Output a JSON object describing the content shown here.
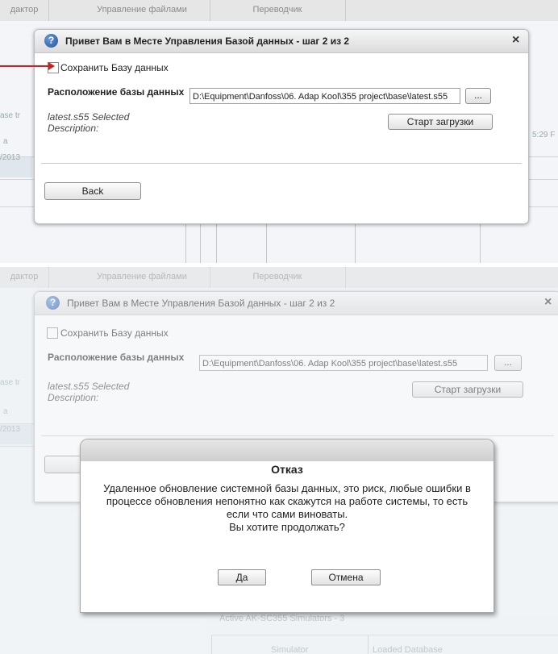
{
  "app": {
    "tabs": [
      "дактор",
      "Управление файлами",
      "Переводчик"
    ],
    "bg_left_labels": [
      "ase tr",
      "a",
      "/2013"
    ],
    "bg_time": "5:29 F",
    "bg_section_title": "Active AK-SC355 Simulators - 3",
    "bg_table_headers": [
      "Simulator",
      "Loaded Database"
    ]
  },
  "wizard": {
    "title": "Привет Вам в Месте Управления Базой данных - шаг 2 из 2",
    "close_glyph": "×",
    "help_glyph": "?",
    "save_db_label": "Сохранить Базу данных",
    "location_label": "Расположение базы данных",
    "path_value": "D:\\Equipment\\Danfoss\\06. Adap Kool\\355 project\\base\\latest.s55",
    "browse_label": "...",
    "selected_text": "latest.s55 Selected",
    "description_label": "Description:",
    "start_upload_label": "Старт загрузки",
    "back_label": "Back"
  },
  "confirm": {
    "title": "Отказ",
    "message_lines": [
      "Удаленное обновление системной базы данных, это риск, любые ошибки в",
      "процессе обновления непонятно как скажутся на работе системы, то есть",
      "если что сами виноваты.",
      "Вы хотите продолжать?"
    ],
    "yes_label": "Да",
    "cancel_label": "Отмена"
  },
  "colors": {
    "annotation_arrow": "#cc2222",
    "help_icon": "#1f4f9a"
  }
}
